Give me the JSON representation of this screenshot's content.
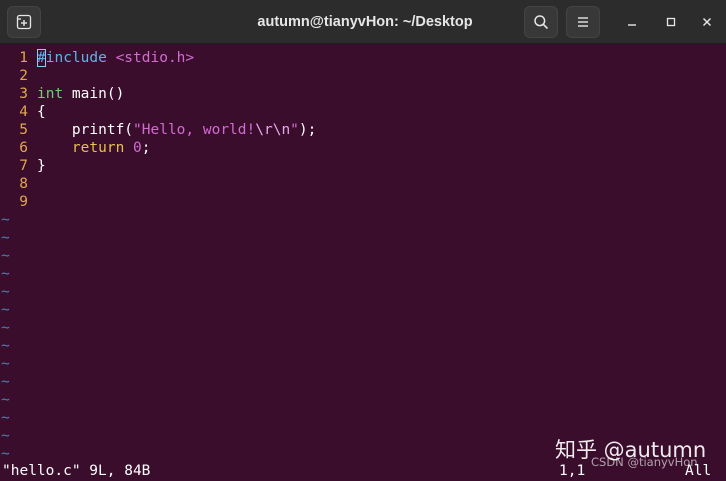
{
  "window": {
    "title": "autumn@tianyvHon: ~/Desktop",
    "icons": {
      "new_tab": "new-tab-icon",
      "search": "search-icon",
      "menu": "hamburger-menu-icon",
      "minimize": "minimize-icon",
      "maximize": "maximize-icon",
      "close": "close-icon"
    }
  },
  "editor": {
    "line_numbers": [
      "1",
      "2",
      "3",
      "4",
      "5",
      "6",
      "7",
      "8",
      "9"
    ],
    "lines": [
      [
        {
          "t": "#",
          "c": "pre",
          "cursor": true
        },
        {
          "t": "include",
          "c": "pre"
        },
        {
          "t": " ",
          "c": "plain"
        },
        {
          "t": "<stdio.h>",
          "c": "hdr"
        }
      ],
      [],
      [
        {
          "t": "int",
          "c": "type"
        },
        {
          "t": " main()",
          "c": "plain"
        }
      ],
      [
        {
          "t": "{",
          "c": "plain"
        }
      ],
      [
        {
          "t": "    printf(",
          "c": "plain"
        },
        {
          "t": "\"Hello, world!",
          "c": "str"
        },
        {
          "t": "\\r\\n",
          "c": "esc"
        },
        {
          "t": "\"",
          "c": "str"
        },
        {
          "t": ");",
          "c": "plain"
        }
      ],
      [
        {
          "t": "    ",
          "c": "plain"
        },
        {
          "t": "return",
          "c": "kw"
        },
        {
          "t": " ",
          "c": "plain"
        },
        {
          "t": "0",
          "c": "num"
        },
        {
          "t": ";",
          "c": "plain"
        }
      ],
      [
        {
          "t": "}",
          "c": "plain"
        }
      ],
      [],
      []
    ],
    "tilde": "~",
    "tilde_count": 14
  },
  "status": {
    "file_info": "\"hello.c\" 9L, 84B",
    "cursor_pos": "1,1",
    "scroll": "All"
  },
  "watermark": {
    "main": "知乎 @autumn",
    "sub": "CSDN @tianyvHon"
  },
  "colors": {
    "background": "#3b0d2c",
    "line_number": "#e0a84c",
    "preprocessor": "#5fb3e8",
    "string": "#d16bd1",
    "type": "#6fd06f",
    "keyword": "#e8c14e",
    "tilde": "#4f7fa8"
  }
}
